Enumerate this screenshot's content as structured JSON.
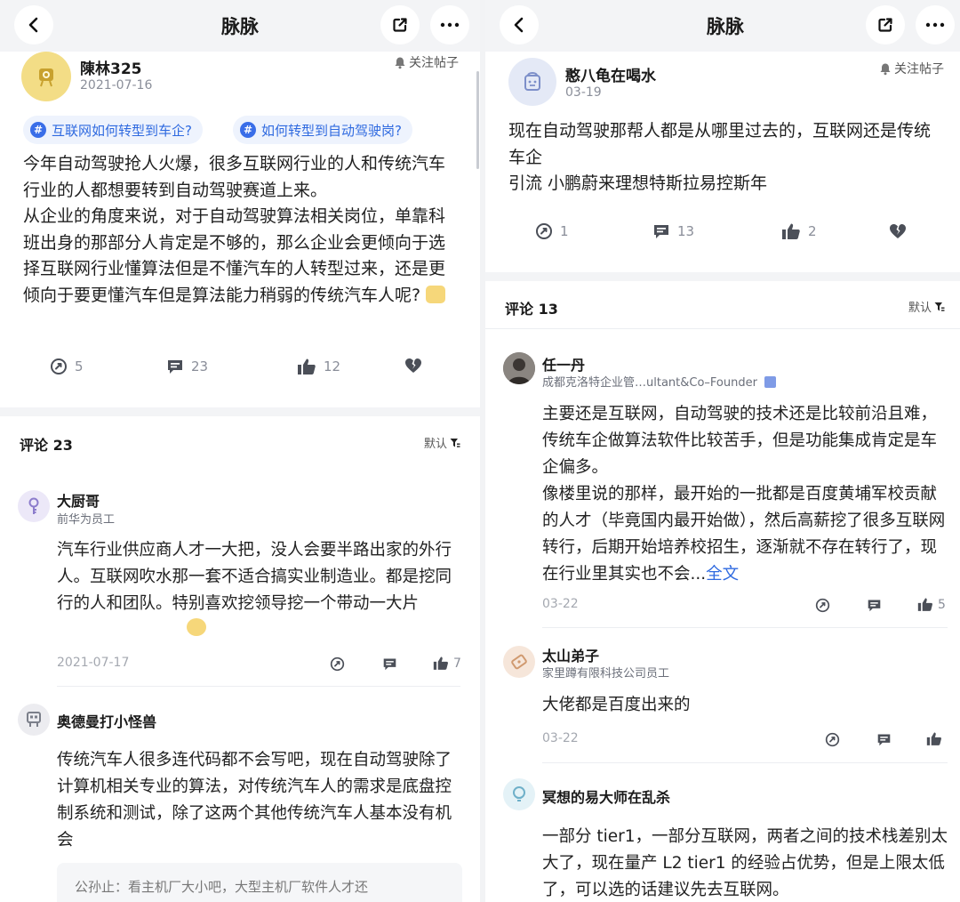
{
  "app": {
    "title": "脉脉"
  },
  "left": {
    "author": {
      "name": "陳林325",
      "date": "2021-07-16",
      "follow": "关注帖子"
    },
    "topics": [
      "互联网如何转型到车企?",
      "如何转型到自动驾驶岗?"
    ],
    "body": "今年自动驾驶抢人火爆，很多互联网行业的人和传统汽车行业的人都想要转到自动驾驶赛道上来。\n从企业的角度来说，对于自动驾驶算法相关岗位，单靠科班出身的那部分人肯定是不够的，那么企业会更倾向于选择互联网行业懂算法但是不懂汽车的人转型过来，还是更倾向于要更懂汽车但是算法能力稍弱的传统汽车人呢?",
    "actions": {
      "share": "5",
      "comment": "23",
      "like": "12"
    },
    "comments_title": "评论 23",
    "sort": "默认",
    "comments": [
      {
        "name": "大厨哥",
        "sub": "前华为员工",
        "body": "汽车行业供应商人才一大把，没人会要半路出家的外行人。互联网吹水那一套不适合搞实业制造业。都是挖同行的人和团队。特别喜欢挖领导挖一个带动一大片",
        "date": "2021-07-17",
        "like": "7"
      },
      {
        "name": "奥德曼打小怪兽",
        "body": "传统汽车人很多连代码都不会写吧，现在自动驾驶除了计算机相关专业的算法，对传统汽车人的需求是底盘控制系统和测试，除了这两个其他传统汽车人基本没有机会",
        "reply": "公孙止：看主机厂大小吧，大型主机厂软件人才还"
      }
    ]
  },
  "right": {
    "author": {
      "name": "憨八龟在喝水",
      "date": "03-19",
      "follow": "关注帖子"
    },
    "body": "现在自动驾驶那帮人都是从哪里过去的，互联网还是传统车企\n引流 小鹏蔚来理想特斯拉易控斯年",
    "actions": {
      "share": "1",
      "comment": "13",
      "like": "2"
    },
    "comments_title": "评论 13",
    "sort": "默认",
    "comments": [
      {
        "name": "任一丹",
        "sub": "成都克洛特企业管…ultant&Co–Founder",
        "body": "主要还是互联网，自动驾驶的技术还是比较前沿且难，传统车企做算法软件比较苦手，但是功能集成肯定是车企偏多。\n像楼里说的那样，最开始的一批都是百度黄埔军校贡献的人才（毕竟国内最开始做），然后高薪挖了很多互联网转行，后期开始培养校招生，逐渐就不存在转行了，现在行业里其实也不会...",
        "more": "全文",
        "date": "03-22",
        "like": "5"
      },
      {
        "name": "太山弟子",
        "sub": "家里蹲有限科技公司员工",
        "body": "大佬都是百度出来的",
        "date": "03-22",
        "like": ""
      },
      {
        "name": "冥想的易大师在乱杀",
        "body": "一部分 tier1，一部分互联网，两者之间的技术栈差别太大了，现在量产 L2 tier1 的经验占优势，但是上限太低了，可以选的话建议先去互联网。"
      }
    ]
  },
  "icons": {
    "back": "chevron-left-icon",
    "share": "share-out-icon",
    "more": "ellipsis-icon",
    "bell": "bell-icon",
    "repost": "repost-icon",
    "comment": "comment-icon",
    "like": "thumbs-up-icon",
    "dislike": "broken-heart-icon",
    "filter": "filter-icon"
  },
  "colors": {
    "accent": "#2f6ae0",
    "topic_bg": "#eef3fd",
    "meta": "#8a8e99"
  }
}
